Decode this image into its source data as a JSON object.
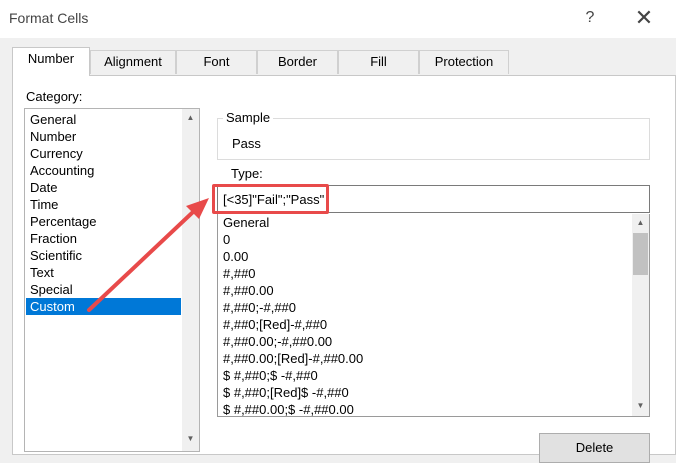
{
  "window": {
    "title": "Format Cells",
    "help": "?",
    "close": "✕"
  },
  "tabs": [
    {
      "label": "Number"
    },
    {
      "label": "Alignment"
    },
    {
      "label": "Font"
    },
    {
      "label": "Border"
    },
    {
      "label": "Fill"
    },
    {
      "label": "Protection"
    }
  ],
  "category": {
    "label": "Category:",
    "items": [
      "General",
      "Number",
      "Currency",
      "Accounting",
      "Date",
      "Time",
      "Percentage",
      "Fraction",
      "Scientific",
      "Text",
      "Special",
      "Custom"
    ],
    "selected": "Custom"
  },
  "sample": {
    "label": "Sample",
    "value": "Pass"
  },
  "type": {
    "label": "Type:",
    "value": "[<35]\"Fail\";\"Pass\"",
    "formats": [
      "General",
      "0",
      "0.00",
      "#,##0",
      "#,##0.00",
      "#,##0;-#,##0",
      "#,##0;[Red]-#,##0",
      "#,##0.00;-#,##0.00",
      "#,##0.00;[Red]-#,##0.00",
      "$ #,##0;$ -#,##0",
      "$ #,##0;[Red]$ -#,##0",
      "$ #,##0.00;$ -#,##0.00"
    ]
  },
  "buttons": {
    "delete": "Delete"
  },
  "colors": {
    "selection": "#0078d7",
    "annotation": "#e84a4a"
  },
  "icons": {
    "scroll_up": "chevron-up-icon",
    "scroll_down": "chevron-down-icon"
  }
}
